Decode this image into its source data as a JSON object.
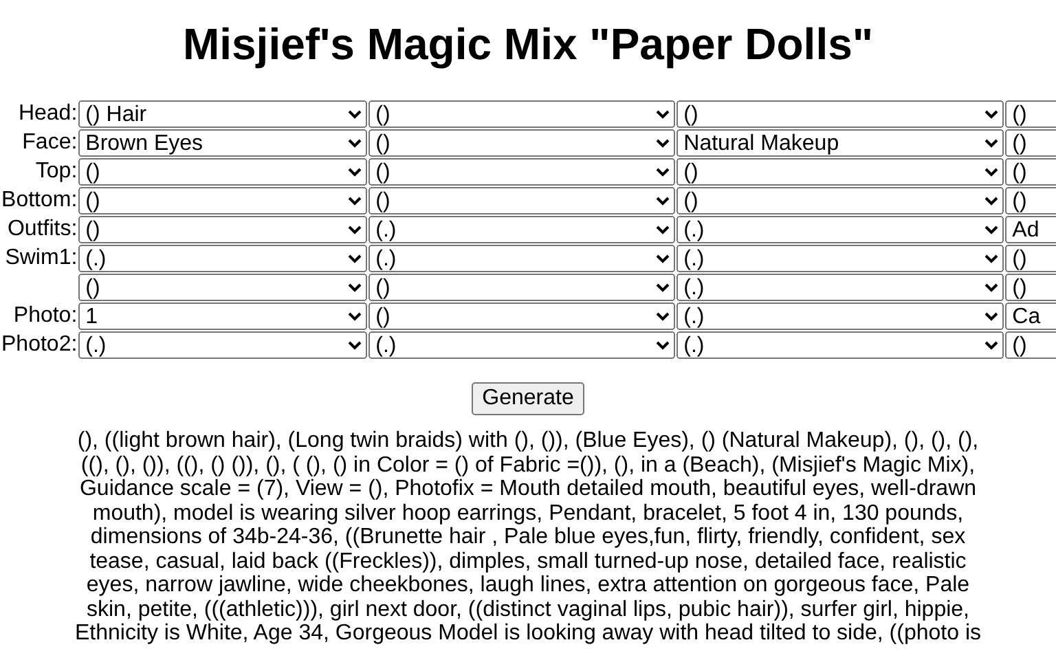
{
  "title": "Misjief's Magic Mix \"Paper Dolls\"",
  "rows": [
    {
      "label": "Head:",
      "selects": [
        "() Hair",
        "()",
        "()",
        "()"
      ]
    },
    {
      "label": "Face:",
      "selects": [
        "Brown Eyes",
        "()",
        "Natural Makeup",
        "()"
      ]
    },
    {
      "label": "Top:",
      "selects": [
        "()",
        "()",
        "()",
        "()"
      ]
    },
    {
      "label": "Bottom:",
      "selects": [
        "()",
        "()",
        "()",
        "()"
      ]
    },
    {
      "label": "Outfits:",
      "selects": [
        "()",
        "(.)",
        "(.)",
        "Ad"
      ]
    },
    {
      "label": "Swim1:",
      "selects": [
        "(.)",
        "(.)",
        "(.)",
        "()"
      ]
    },
    {
      "selects": [
        "()",
        "()",
        "(.)",
        "()"
      ]
    },
    {
      "label": "Photo:",
      "selects": [
        "1",
        "()",
        "(.)",
        "Ca"
      ]
    },
    {
      "label": "Photo2:",
      "selects": [
        "(.)",
        "(.)",
        "(.)",
        "()"
      ]
    }
  ],
  "button": "Generate",
  "prompt": "(), ((light brown hair), (Long twin braids) with (), ()), (Blue Eyes), () (Natural Makeup), (), (), (), ((), (), ()), ((), () ()), (), ( (), () in Color = () of Fabric =()), (), in a (Beach), (Misjief's Magic Mix), Guidance scale = (7), View = (), Photofix = Mouth detailed mouth, beautiful eyes, well-drawn mouth), model is wearing silver hoop earrings, Pendant, bracelet, 5 foot 4 in, 130 pounds, dimensions of 34b-24-36, ((Brunette hair , Pale blue eyes,fun, flirty, friendly, confident, sex tease, casual, laid back ((Freckles)), dimples, small turned-up nose, detailed face, realistic eyes, narrow jawline, wide cheekbones, laugh lines, extra attention on gorgeous face, Pale skin, petite, (((athletic))), girl next door, ((distinct vaginal lips, pubic hair)), surfer girl, hippie, Ethnicity is White, Age 34, Gorgeous Model is looking away with head tilted to side, ((photo is"
}
